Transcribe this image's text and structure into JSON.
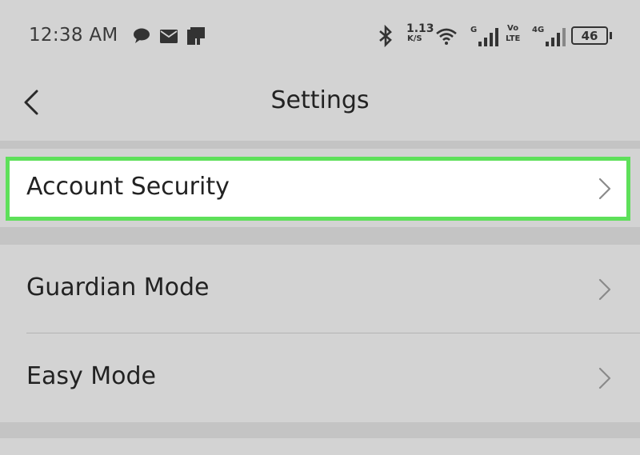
{
  "status_bar": {
    "time": "12:38 AM",
    "notification_icons": [
      "chat-bubble-icon",
      "mail-icon",
      "clipboard-icon"
    ],
    "net_speed_value": "1.13",
    "net_speed_unit": "K/S",
    "signal_1_label": "G",
    "volte_top": "Vo",
    "volte_bottom": "LTE",
    "signal_2_label": "4G",
    "battery_level": "46"
  },
  "header": {
    "title": "Settings"
  },
  "settings": {
    "account_security": "Account Security",
    "guardian_mode": "Guardian Mode",
    "easy_mode": "Easy Mode"
  },
  "colors": {
    "highlight_border": "#5ee05a",
    "background": "#c4c4c4",
    "panel": "#d3d3d3"
  }
}
